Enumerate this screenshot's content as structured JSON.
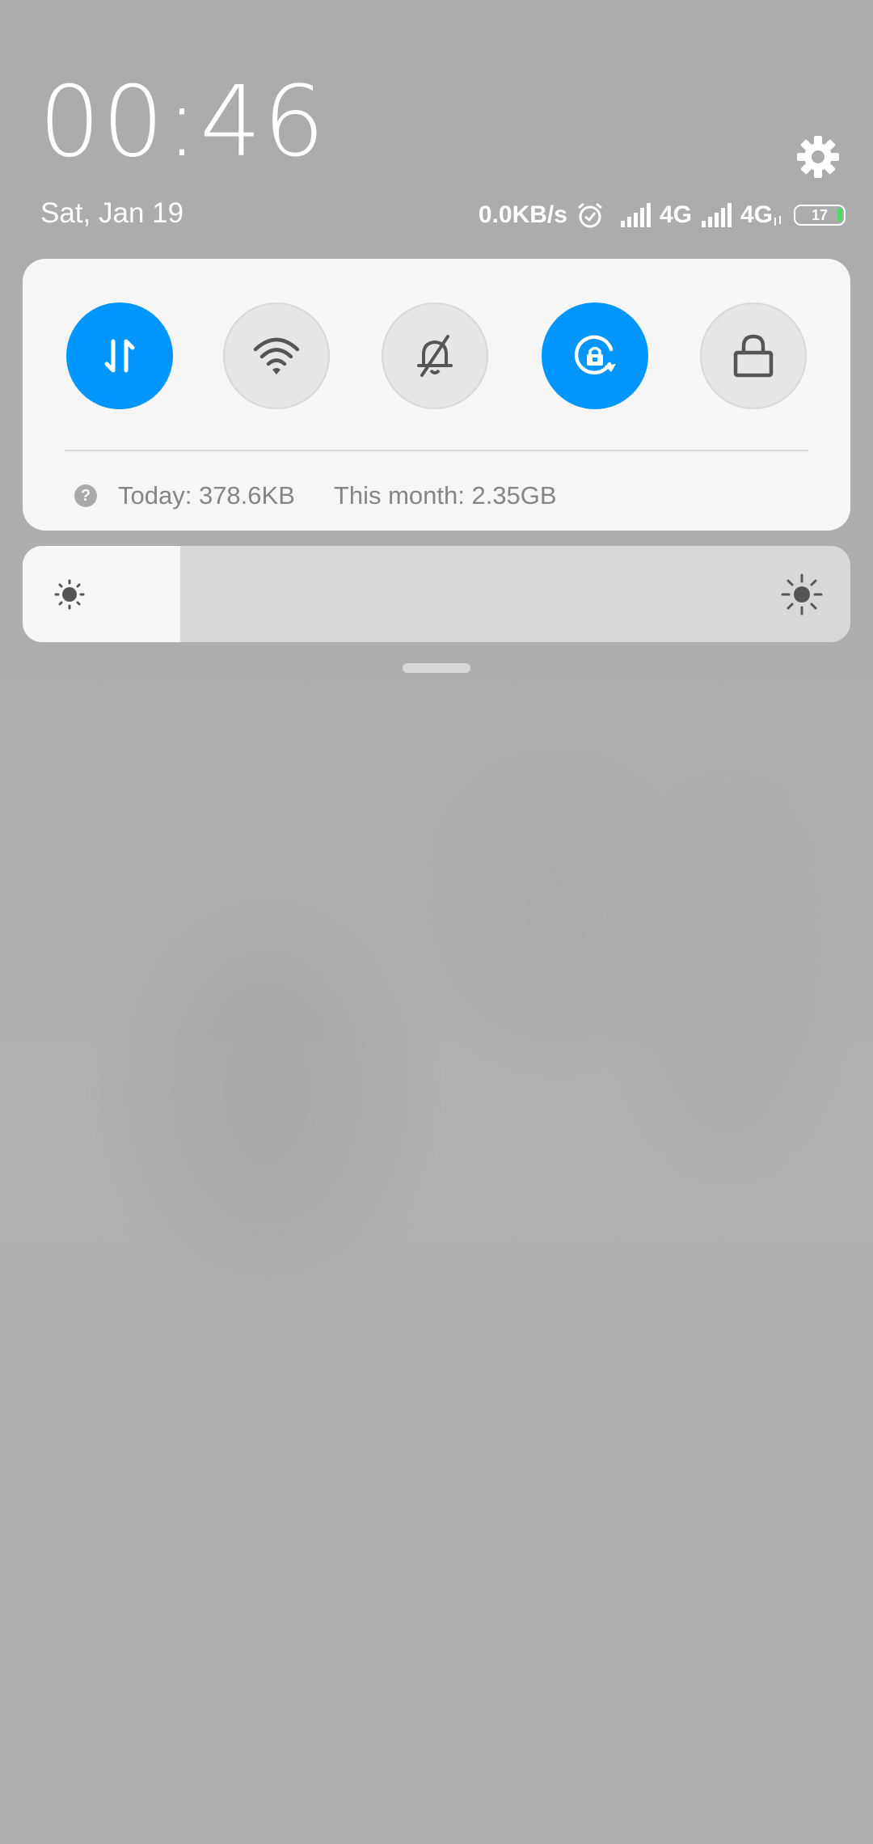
{
  "header": {
    "time": "00:46",
    "date": "Sat, Jan 19"
  },
  "status_bar": {
    "net_speed": "0.0KB/s",
    "sim1_network": "4G",
    "sim2_network": "4G",
    "battery_level": "17",
    "icons": [
      "alarm-icon",
      "signal-icon",
      "signal-icon",
      "data-activity-icon",
      "battery-icon"
    ]
  },
  "toggles": [
    {
      "name": "mobile-data",
      "icon": "data-arrows-icon",
      "state": "on"
    },
    {
      "name": "wifi",
      "icon": "wifi-icon",
      "state": "off"
    },
    {
      "name": "silent",
      "icon": "bell-off-icon",
      "state": "off"
    },
    {
      "name": "rotation-lock",
      "icon": "rotation-lock-icon",
      "state": "on"
    },
    {
      "name": "lock-screen",
      "icon": "lock-icon",
      "state": "off"
    }
  ],
  "data_usage": {
    "help_glyph": "?",
    "today": "Today: 378.6KB",
    "month": "This month: 2.35GB"
  },
  "brightness": {
    "level_fraction": 0.19
  },
  "colors": {
    "accent": "#0195fe",
    "card": "#f6f6f6",
    "toggle_off": "#e6e6e6",
    "battery_fill": "#4cd964"
  }
}
